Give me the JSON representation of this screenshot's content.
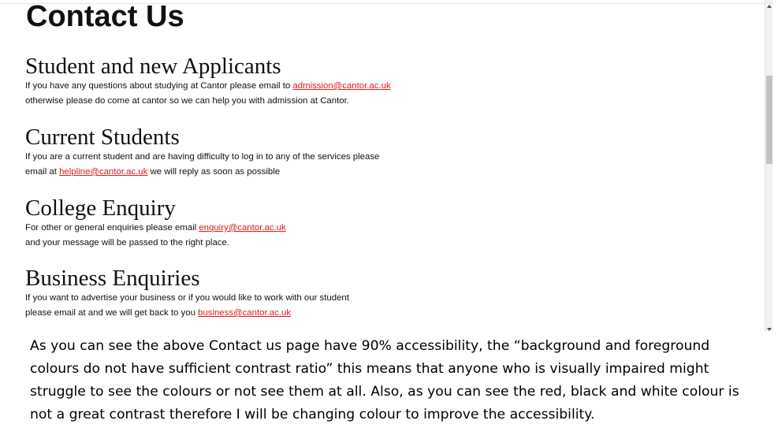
{
  "page": {
    "title": "Contact Us",
    "sections": [
      {
        "heading": "Student and new Applicants",
        "line1_text": "If you have any questions about studying at Cantor please email to ",
        "line1_link": "admission@cantor.ac.uk",
        "line2_text": "otherwise please do come at cantor so we can help you with admission at Cantor."
      },
      {
        "heading": "Current Students",
        "line1_text": "If you are a current student and are having difficulty to log in to any of the services please",
        "line2_text_before": "email at ",
        "line2_link": "helpline@cantor.ac.uk",
        "line2_text_after": " we will reply as soon as possible"
      },
      {
        "heading": "College Enquiry",
        "line1_text": "For other or general enquiries please email ",
        "line1_link": "enquiry@cantor.ac.uk",
        "line2_text": "and your message will be passed to the right place."
      },
      {
        "heading": "Business Enquiries",
        "line1_text": "If you want to advertise your business or if you would like to work with our student",
        "line2_text_before": "please email at and we will get back to you ",
        "line2_link": "business@cantor.ac.uk"
      }
    ]
  },
  "caption": {
    "text": "As you can see the above Contact us page have 90% accessibility, the “background and foreground colours do not have sufficient contrast ratio” this means that anyone who is visually impaired might struggle to see the colours or not see them at all. Also, as you can see the red, black and white colour is not a great contrast therefore I will be changing colour to improve the accessibility."
  },
  "colors": {
    "link": "#e01b1b",
    "text": "#111111",
    "background": "#ffffff"
  }
}
